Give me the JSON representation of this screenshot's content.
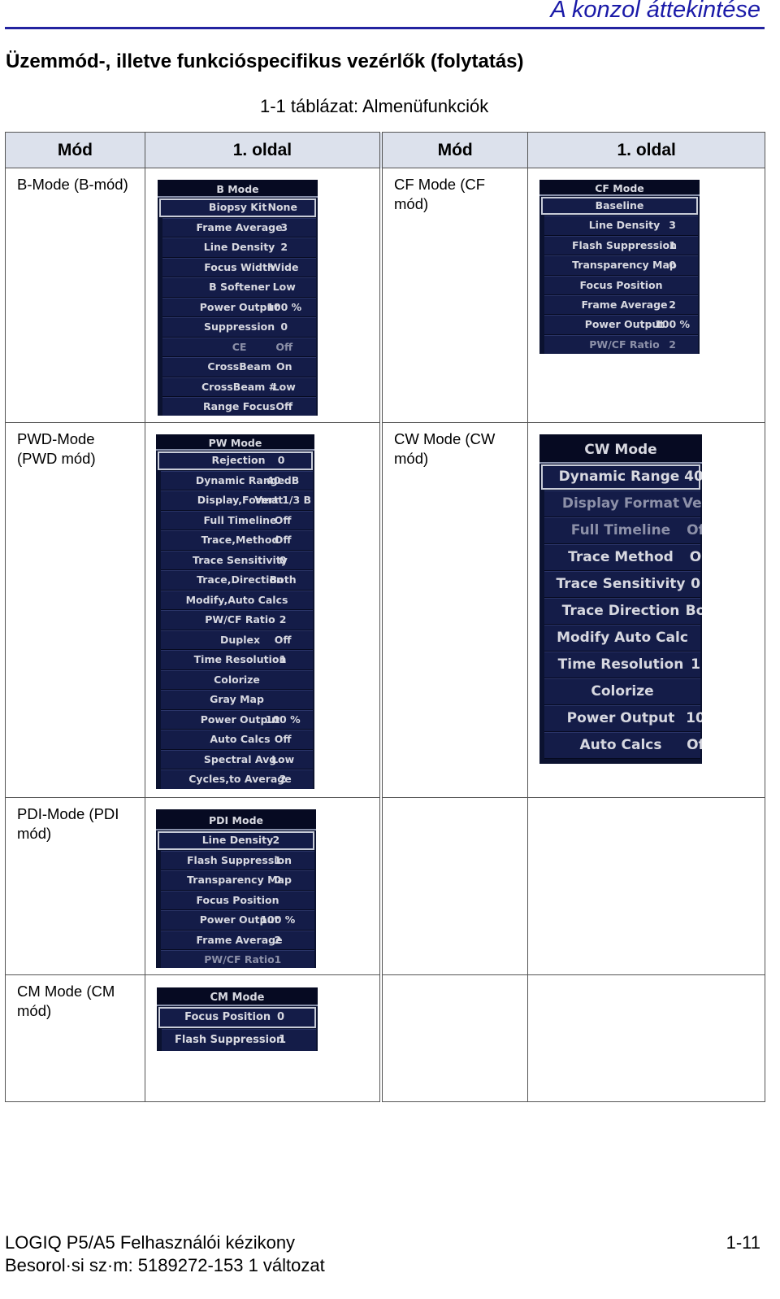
{
  "header": {
    "running_title": "A konzol áttekintése",
    "section_title": "Üzemmód-, illetve funkcióspecifikus vezérlők (folytatás)",
    "table_caption": "1-1  táblázat: Almenüfunkciók"
  },
  "table": {
    "headers": [
      "Mód",
      "1. oldal",
      "Mód",
      "1. oldal"
    ],
    "modes": {
      "b": "B-Mode (B-mód)",
      "cf": "CF Mode (CF mód)",
      "pwd": "PWD-Mode (PWD mód)",
      "cw": "CW Mode (CW mód)",
      "pdi": "PDI-Mode (PDI mód)",
      "cm": "CM Mode (CM mód)"
    }
  },
  "colors": {
    "menu_background": "#0b1230",
    "menu_row": "#141c48",
    "menu_text": "#d7d8e0",
    "heading_blue": "#1a1aa8",
    "table_header": "#dce1ec"
  },
  "menus": {
    "b": {
      "title": "B Mode",
      "items": [
        {
          "label": "Biopsy Kit",
          "value": "None",
          "selected": true
        },
        {
          "label": "Frame Average",
          "value": "3"
        },
        {
          "label": "Line Density",
          "value": "2"
        },
        {
          "label": "Focus Width",
          "value": "Wide"
        },
        {
          "label": "B Softener",
          "value": "Low"
        },
        {
          "label": "Power Output",
          "value": "100 %"
        },
        {
          "label": "Suppression",
          "value": "0"
        },
        {
          "label": "CE",
          "value": "Off",
          "dim": true
        },
        {
          "label": "CrossBeam",
          "value": "On"
        },
        {
          "label": "CrossBeam #",
          "value": "Low"
        },
        {
          "label": "Range Focus",
          "value": "Off"
        }
      ]
    },
    "cf": {
      "title": "CF Mode",
      "items": [
        {
          "label": "Baseline",
          "value": "",
          "selected": true
        },
        {
          "label": "Line Density",
          "value": "3"
        },
        {
          "label": "Flash Suppression",
          "value": "1"
        },
        {
          "label": "Transparency Map",
          "value": "0"
        },
        {
          "label": "Focus Position",
          "value": ""
        },
        {
          "label": "Frame Average",
          "value": "2"
        },
        {
          "label": "Power Output",
          "value": "100 %"
        },
        {
          "label": "PW/CF Ratio",
          "value": "2",
          "dim": true
        }
      ]
    },
    "pw": {
      "title": "PW Mode",
      "items": [
        {
          "label": "Rejection",
          "value": "0",
          "selected": true
        },
        {
          "label": "Dynamic Range",
          "value": "40 dB"
        },
        {
          "label": "Display,Format",
          "value": "Vert 1/3 B"
        },
        {
          "label": "Full Timeline",
          "value": "Off"
        },
        {
          "label": "Trace,Method",
          "value": "Off"
        },
        {
          "label": "Trace Sensitivity",
          "value": "0"
        },
        {
          "label": "Trace,Direction",
          "value": "Both"
        },
        {
          "label": "Modify,Auto Calcs",
          "value": ""
        },
        {
          "label": "PW/CF Ratio",
          "value": "2"
        },
        {
          "label": "Duplex",
          "value": "Off"
        },
        {
          "label": "Time Resolution",
          "value": "1"
        },
        {
          "label": "Colorize",
          "value": ""
        },
        {
          "label": "Gray Map",
          "value": ""
        },
        {
          "label": "Power Output",
          "value": "100 %"
        },
        {
          "label": "Auto Calcs",
          "value": "Off"
        },
        {
          "label": "Spectral Avg",
          "value": "Low"
        },
        {
          "label": "Cycles,to Average",
          "value": "2"
        }
      ]
    },
    "cw": {
      "title": "CW Mode",
      "items": [
        {
          "label": "Dynamic Range",
          "value": "40",
          "selected": true
        },
        {
          "label": "Display Format",
          "value": "Ver",
          "dim": true
        },
        {
          "label": "Full Timeline",
          "value": "Of",
          "dim": true
        },
        {
          "label": "Trace Method",
          "value": "O"
        },
        {
          "label": "Trace Sensitivity",
          "value": "0"
        },
        {
          "label": "Trace Direction",
          "value": "Bo"
        },
        {
          "label": "Modify Auto Calc",
          "value": ""
        },
        {
          "label": "Time Resolution",
          "value": "1"
        },
        {
          "label": "Colorize",
          "value": ""
        },
        {
          "label": "Power Output",
          "value": "10"
        },
        {
          "label": "Auto Calcs",
          "value": "Of"
        }
      ]
    },
    "pdi": {
      "title": "PDI Mode",
      "items": [
        {
          "label": "Line Density",
          "value": "2",
          "selected": true
        },
        {
          "label": "Flash Suppression",
          "value": "1"
        },
        {
          "label": "Transparency Map",
          "value": "0"
        },
        {
          "label": "Focus Position",
          "value": ""
        },
        {
          "label": "Power Output",
          "value": "100 %"
        },
        {
          "label": "Frame Average",
          "value": "2"
        },
        {
          "label": "PW/CF Ratio",
          "value": "1",
          "dim": true
        }
      ]
    },
    "cm": {
      "title": "CM Mode",
      "items": [
        {
          "label": "Focus Position",
          "value": "0",
          "selected": true
        },
        {
          "label": "Flash Suppression",
          "value": "1"
        }
      ]
    }
  },
  "footer": {
    "title": "LOGIQ P5/A5 Felhasználói kézikony",
    "doc_number": "Besorol·si sz·m: 5189272-153 1 változat",
    "page": "1-11"
  }
}
